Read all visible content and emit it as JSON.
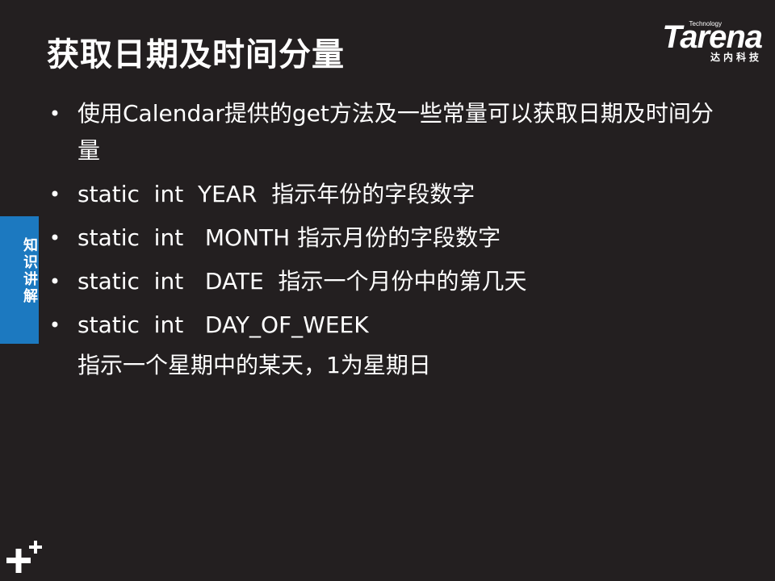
{
  "slide": {
    "title": "获取日期及时间分量",
    "logo": {
      "tagline": "Technology",
      "wordmark": "Tarena",
      "subtitle": "达内科技"
    },
    "side_tab": "知识讲解",
    "bullets": [
      {
        "text": "使用Calendar提供的get方法及一些常量可以获取日期及时间分量"
      },
      {
        "text": "static  int  YEAR  指示年份的字段数字"
      },
      {
        "text": "static  int   MONTH 指示月份的字段数字"
      },
      {
        "text": "static  int   DATE  指示一个月份中的第几天"
      },
      {
        "text": "static  int   DAY_OF_WEEK"
      }
    ],
    "continuation": "指示一个星期中的某天，1为星期日",
    "colors": {
      "background": "#231f20",
      "text": "#ffffff",
      "side_tab": "#1c79c0"
    },
    "icons": {
      "corner": "plus-plus-icon",
      "bullet": "bullet-dot"
    }
  }
}
